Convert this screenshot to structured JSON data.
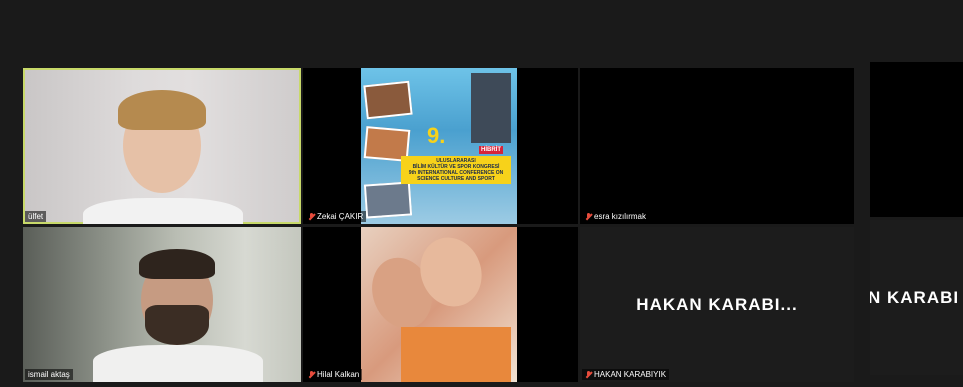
{
  "participants": [
    {
      "name": "ülfet",
      "muted": false
    },
    {
      "name": "Zekai ÇAKIR",
      "muted": true
    },
    {
      "name": "esra kızılırmak",
      "muted": true
    },
    {
      "name": "ismail aktaş",
      "muted": false
    },
    {
      "name": "Hilal Kalkan",
      "muted": true
    },
    {
      "name": "HAKAN KARABIYIK",
      "muted": true,
      "display": "HAKAN  KARABI..."
    },
    {
      "name": "",
      "muted": false,
      "display": "N  KARABI"
    }
  ],
  "poster": {
    "number": "9.",
    "hybrid": "HİBRİT",
    "line1": "ULUSLARARASI",
    "line2": "BİLİM KÜLTÜR VE SPOR KONGRESİ",
    "line3": "9th INTERNATIONAL CONFERENCE ON",
    "line4": "SCIENCE CULTURE AND SPORT"
  },
  "colors": {
    "active_speaker": "#c8d96a",
    "mute": "#e74c3c",
    "background": "#1a1a1a"
  }
}
